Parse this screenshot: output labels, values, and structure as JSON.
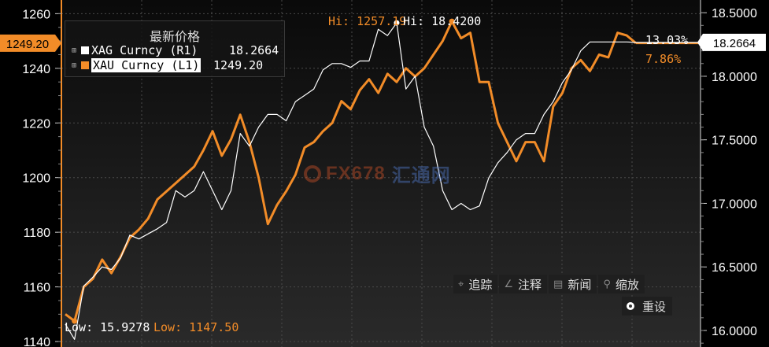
{
  "colors": {
    "xau": "#f28c28",
    "xag": "#ffffff",
    "bg": "#000000",
    "grid": "#4a4a4a"
  },
  "legend": {
    "title": "最新价格",
    "xag_label": "XAG Curncy (R1)",
    "xag_value": "18.2664",
    "xau_label": "XAU Curncy (L1)",
    "xau_value": "1249.20"
  },
  "annotations": {
    "xau_hi": "Hi: 1257.19",
    "xag_hi": "Hi: 18.4200",
    "xag_low": "Low: 15.9278",
    "xau_low": "Low: 1147.50",
    "xag_change": "13.03%",
    "xau_change": "7.86%",
    "xau_last": "1249.20",
    "xag_last": "18.2664"
  },
  "toolbar": {
    "track": "追踪",
    "annotate": "注释",
    "news": "新闻",
    "zoom": "缩放",
    "reset": "重设"
  },
  "watermark": {
    "text": "FX678",
    "cn": "汇通网"
  },
  "chart_data": {
    "type": "line",
    "left_axis": {
      "ticks": [
        1140,
        1160,
        1180,
        1200,
        1220,
        1240,
        1260
      ],
      "ylim": [
        1138,
        1265
      ]
    },
    "right_axis": {
      "ticks": [
        16.0,
        16.5,
        17.0,
        17.5,
        18.0,
        18.5
      ],
      "ylim": [
        15.87,
        18.6
      ]
    },
    "grid": true,
    "series": [
      {
        "name": "XAU Curncy (L1)",
        "axis": "left",
        "values": [
          1150,
          1147.5,
          1160,
          1163,
          1170,
          1165,
          1171,
          1178,
          1181,
          1185,
          1192,
          1195,
          1198,
          1201,
          1204,
          1210,
          1217,
          1208,
          1214,
          1223,
          1213,
          1200,
          1183,
          1190,
          1195,
          1201,
          1211,
          1213,
          1217,
          1220,
          1228,
          1225,
          1232,
          1236,
          1231,
          1238,
          1235,
          1240,
          1237,
          1240,
          1245,
          1250,
          1257.19,
          1251,
          1253,
          1235,
          1235,
          1220,
          1213,
          1206,
          1213,
          1213,
          1206,
          1226,
          1231,
          1240,
          1243,
          1239,
          1245,
          1244,
          1253,
          1252,
          1249.2
        ]
      },
      {
        "name": "XAG Curncy (R1)",
        "axis": "right",
        "values": [
          16.05,
          15.93,
          16.35,
          16.42,
          16.5,
          16.48,
          16.57,
          16.75,
          16.72,
          16.76,
          16.8,
          16.85,
          17.1,
          17.05,
          17.1,
          17.25,
          17.1,
          16.95,
          17.1,
          17.55,
          17.45,
          17.6,
          17.7,
          17.7,
          17.65,
          17.8,
          17.85,
          17.9,
          18.05,
          18.1,
          18.1,
          18.07,
          18.12,
          18.12,
          18.37,
          18.32,
          18.42,
          17.9,
          18.0,
          17.6,
          17.45,
          17.1,
          16.95,
          17.0,
          16.95,
          16.98,
          17.2,
          17.32,
          17.4,
          17.5,
          17.55,
          17.55,
          17.7,
          17.8,
          17.95,
          18.05,
          18.2,
          18.27,
          18.27,
          18.27,
          18.27,
          18.27,
          18.2664
        ]
      }
    ]
  }
}
